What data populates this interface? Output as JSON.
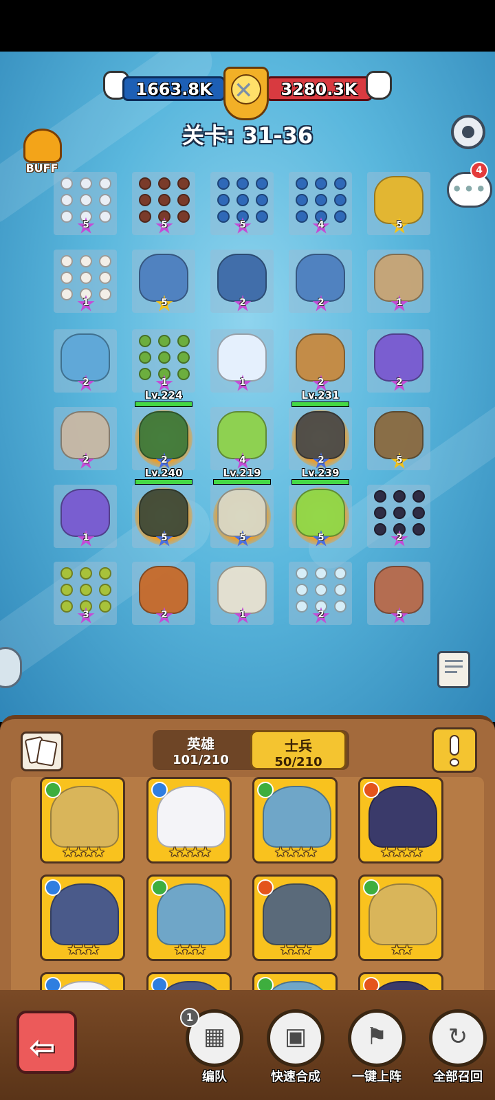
{
  "power": {
    "left": "1663.8K",
    "right": "3280.3K"
  },
  "level_title": "关卡: 31-36",
  "buff_label": "BUFF",
  "chat_badge": "4",
  "colors": {
    "left_team": "#1d5fb5",
    "right_team": "#d83a40",
    "panel": "#a36a3c",
    "card": "#f9c21e",
    "accent_tab": "#f4c430"
  },
  "board": [
    {
      "row": 0,
      "col": 0,
      "star": "5",
      "tone": "purple",
      "unit": "white-squad",
      "hero": false
    },
    {
      "row": 0,
      "col": 1,
      "star": "5",
      "tone": "purple",
      "unit": "crossbow-squad",
      "hero": false
    },
    {
      "row": 0,
      "col": 2,
      "star": "5",
      "tone": "purple",
      "unit": "blue-squad",
      "hero": false
    },
    {
      "row": 0,
      "col": 3,
      "star": "4",
      "tone": "purple",
      "unit": "blue-squad",
      "hero": false
    },
    {
      "row": 0,
      "col": 4,
      "star": "5",
      "tone": "yellow",
      "unit": "gold-beast",
      "hero": false
    },
    {
      "row": 1,
      "col": 0,
      "star": "1",
      "tone": "purple",
      "unit": "chicken-squad",
      "hero": false
    },
    {
      "row": 1,
      "col": 1,
      "star": "5",
      "tone": "yellow",
      "unit": "dragon",
      "hero": false
    },
    {
      "row": 1,
      "col": 2,
      "star": "2",
      "tone": "purple",
      "unit": "storm-golem",
      "hero": false
    },
    {
      "row": 1,
      "col": 3,
      "star": "2",
      "tone": "purple",
      "unit": "dragon",
      "hero": false
    },
    {
      "row": 1,
      "col": 4,
      "star": "1",
      "tone": "purple",
      "unit": "serpent",
      "hero": false
    },
    {
      "row": 2,
      "col": 0,
      "star": "2",
      "tone": "purple",
      "unit": "blue-beast",
      "hero": false
    },
    {
      "row": 2,
      "col": 1,
      "star": "1",
      "tone": "purple",
      "unit": "goblin-squad",
      "hero": false
    },
    {
      "row": 2,
      "col": 2,
      "star": "1",
      "tone": "purple",
      "unit": "ghost",
      "hero": false
    },
    {
      "row": 2,
      "col": 3,
      "star": "2",
      "tone": "purple",
      "unit": "cannoneer",
      "hero": false
    },
    {
      "row": 2,
      "col": 4,
      "star": "2",
      "tone": "purple",
      "unit": "spider",
      "hero": false
    },
    {
      "row": 3,
      "col": 0,
      "star": "2",
      "tone": "purple",
      "unit": "caveman",
      "hero": false
    },
    {
      "row": 3,
      "col": 1,
      "star": "2",
      "tone": "blue",
      "unit": "hero-warrior",
      "hero": true,
      "lv": "Lv.224"
    },
    {
      "row": 3,
      "col": 2,
      "star": "4",
      "tone": "purple",
      "unit": "slime-archer",
      "hero": false
    },
    {
      "row": 3,
      "col": 3,
      "star": "2",
      "tone": "blue",
      "unit": "hero-brute",
      "hero": true,
      "lv": "Lv.231"
    },
    {
      "row": 3,
      "col": 4,
      "star": "5",
      "tone": "yellow",
      "unit": "ballista",
      "hero": false
    },
    {
      "row": 4,
      "col": 0,
      "star": "1",
      "tone": "purple",
      "unit": "spider",
      "hero": false
    },
    {
      "row": 4,
      "col": 1,
      "star": "5",
      "tone": "blue",
      "unit": "hero-gunner",
      "hero": true,
      "lv": "Lv.240"
    },
    {
      "row": 4,
      "col": 2,
      "star": "5",
      "tone": "blue",
      "unit": "hero-monk",
      "hero": true,
      "lv": "Lv.219"
    },
    {
      "row": 4,
      "col": 3,
      "star": "5",
      "tone": "blue",
      "unit": "hero-mage",
      "hero": true,
      "lv": "Lv.239"
    },
    {
      "row": 4,
      "col": 4,
      "star": "2",
      "tone": "purple",
      "unit": "dark-squad",
      "hero": false
    },
    {
      "row": 5,
      "col": 0,
      "star": "3",
      "tone": "purple",
      "unit": "mosquito-squad",
      "hero": false
    },
    {
      "row": 5,
      "col": 1,
      "star": "2",
      "tone": "purple",
      "unit": "monkey",
      "hero": false
    },
    {
      "row": 5,
      "col": 2,
      "star": "1",
      "tone": "purple",
      "unit": "turret",
      "hero": false
    },
    {
      "row": 5,
      "col": 3,
      "star": "2",
      "tone": "purple",
      "unit": "ice-squad",
      "hero": false
    },
    {
      "row": 5,
      "col": 4,
      "star": "5",
      "tone": "purple",
      "unit": "brawler",
      "hero": false
    }
  ],
  "tabs": {
    "hero": {
      "label": "英雄",
      "count": "101/210"
    },
    "soldier": {
      "label": "士兵",
      "count": "50/210"
    }
  },
  "cards": [
    {
      "element": "leaf",
      "stars": "★★★★",
      "art": "robot-gold"
    },
    {
      "element": "water",
      "stars": "★★★★",
      "art": "hooded-spirit"
    },
    {
      "element": "leaf",
      "stars": "★★★★",
      "art": "armored-warrior"
    },
    {
      "element": "fire",
      "stars": "★★★★",
      "art": "dark-mage"
    },
    {
      "element": "water",
      "stars": "★★★",
      "art": "wolf"
    },
    {
      "element": "leaf",
      "stars": "★★★",
      "art": "armored-warrior"
    },
    {
      "element": "fire",
      "stars": "★★★",
      "art": "ice-altar"
    },
    {
      "element": "leaf",
      "stars": "★★",
      "art": "robot-gold"
    },
    {
      "element": "water",
      "stars": "",
      "art": "hooded-spirit"
    },
    {
      "element": "water",
      "stars": "",
      "art": "wolf"
    },
    {
      "element": "leaf",
      "stars": "",
      "art": "armored-warrior"
    },
    {
      "element": "fire",
      "stars": "",
      "art": "dark-mage"
    }
  ],
  "actions": [
    {
      "label": "编队",
      "icon": "team-icon",
      "badge": "1"
    },
    {
      "label": "快速合成",
      "icon": "merge-icon",
      "badge": ""
    },
    {
      "label": "一键上阵",
      "icon": "deploy-flag-icon",
      "badge": ""
    },
    {
      "label": "全部召回",
      "icon": "recall-icon",
      "badge": ""
    }
  ]
}
